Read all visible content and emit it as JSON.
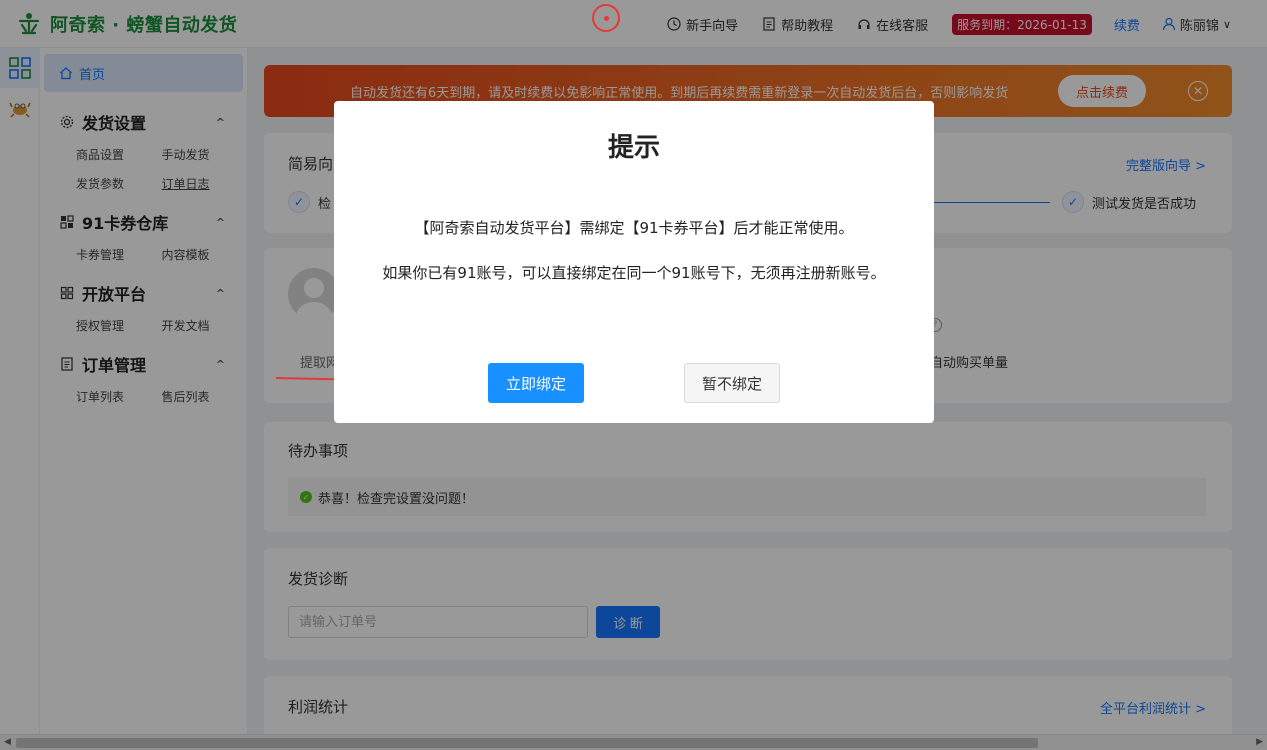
{
  "header": {
    "logo_text": "阿奇索 · 螃蟹自动发货",
    "nav": [
      {
        "label": "新手向导"
      },
      {
        "label": "帮助教程"
      },
      {
        "label": "在线客服"
      }
    ],
    "service_badge": "服务到期：2026-01-13",
    "renew": "续费",
    "user_name": "陈丽锦"
  },
  "sidebar": {
    "home": "首页",
    "sections": [
      {
        "title": "发货设置",
        "items": [
          "商品设置",
          "手动发货",
          "发货参数",
          "订单日志"
        ]
      },
      {
        "title": "91卡券仓库",
        "items": [
          "卡券管理",
          "内容模板"
        ]
      },
      {
        "title": "开放平台",
        "items": [
          "授权管理",
          "开发文档"
        ]
      },
      {
        "title": "订单管理",
        "items": [
          "订单列表",
          "售后列表"
        ]
      }
    ]
  },
  "banner": {
    "text": "自动发货还有6天到期，请及时续费以免影响正常使用。到期后再续费需重新登录一次自动发货后台，否则影响发货",
    "button": "点击续费"
  },
  "wizard": {
    "title": "简易向",
    "link": "完整版向导 >",
    "step1": "检",
    "step_last": "测试发货是否成功"
  },
  "profile": {
    "label": "提取网",
    "right_text": "自动购买单量"
  },
  "todo": {
    "title": "待办事项",
    "message": "恭喜！检查完设置没问题！"
  },
  "diagnosis": {
    "title": "发货诊断",
    "placeholder": "请输入订单号",
    "button": "诊 断"
  },
  "profit": {
    "title": "利润统计",
    "link": "全平台利润统计 >"
  },
  "dialog": {
    "title": "提示",
    "line1": "【阿奇索自动发货平台】需绑定【91卡券平台】后才能正常使用。",
    "line2": "如果你已有91账号，可以直接绑定在同一个91账号下，无须再注册新账号。",
    "confirm": "立即绑定",
    "cancel": "暂不绑定"
  },
  "colors": {
    "brand_green": "#1e8e3e",
    "primary_blue": "#1890ff",
    "banner_orange": "#e8481d",
    "badge_red": "#c8102e",
    "annotation_red": "#e53935"
  }
}
